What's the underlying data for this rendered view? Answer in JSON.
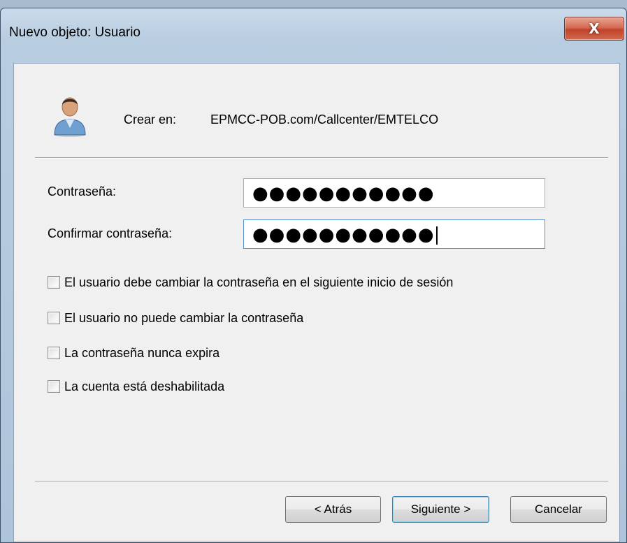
{
  "window": {
    "title": "Nuevo objeto: Usuario",
    "close_glyph": "X"
  },
  "header": {
    "icon": "user-icon",
    "create_in_label": "Crear en:",
    "create_in_path": "EPMCC-POB.com/Callcenter/EMTELCO"
  },
  "form": {
    "password_label": "Contraseña:",
    "password_value": "●●●●●●●●●●●",
    "confirm_label": "Confirmar contraseña:",
    "confirm_value": "●●●●●●●●●●●"
  },
  "options": [
    {
      "label": "El usuario debe cambiar la contraseña en el siguiente inicio de sesión",
      "checked": false
    },
    {
      "label": "El usuario no puede cambiar la contraseña",
      "checked": false
    },
    {
      "label": "La contraseña nunca expira",
      "checked": false
    },
    {
      "label": "La cuenta está deshabilitada",
      "checked": false
    }
  ],
  "buttons": {
    "back": "< Atrás",
    "next": "Siguiente >",
    "cancel": "Cancelar"
  }
}
